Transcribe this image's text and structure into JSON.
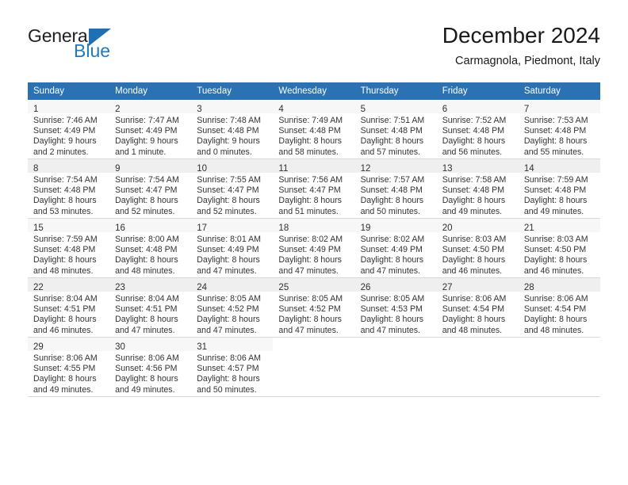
{
  "logo": {
    "word_one": "General",
    "word_two": "Blue",
    "triangle_color": "#1f6fb5",
    "blue_color": "#1f7ac0"
  },
  "header": {
    "title": "December 2024",
    "subtitle": "Carmagnola, Piedmont, Italy"
  },
  "theme": {
    "header_bg": "#2b72b4",
    "header_text": "#ffffff",
    "row_band_shaded": "#efefef",
    "row_band_light": "#f7f7f7",
    "cell_border": "#d8d8d8"
  },
  "calendar": {
    "weekday_headers": [
      "Sunday",
      "Monday",
      "Tuesday",
      "Wednesday",
      "Thursday",
      "Friday",
      "Saturday"
    ],
    "weeks": [
      {
        "shaded": false,
        "days": [
          {
            "day": "1",
            "sunrise": "Sunrise: 7:46 AM",
            "sunset": "Sunset: 4:49 PM",
            "daylight_1": "Daylight: 9 hours",
            "daylight_2": "and 2 minutes."
          },
          {
            "day": "2",
            "sunrise": "Sunrise: 7:47 AM",
            "sunset": "Sunset: 4:49 PM",
            "daylight_1": "Daylight: 9 hours",
            "daylight_2": "and 1 minute."
          },
          {
            "day": "3",
            "sunrise": "Sunrise: 7:48 AM",
            "sunset": "Sunset: 4:48 PM",
            "daylight_1": "Daylight: 9 hours",
            "daylight_2": "and 0 minutes."
          },
          {
            "day": "4",
            "sunrise": "Sunrise: 7:49 AM",
            "sunset": "Sunset: 4:48 PM",
            "daylight_1": "Daylight: 8 hours",
            "daylight_2": "and 58 minutes."
          },
          {
            "day": "5",
            "sunrise": "Sunrise: 7:51 AM",
            "sunset": "Sunset: 4:48 PM",
            "daylight_1": "Daylight: 8 hours",
            "daylight_2": "and 57 minutes."
          },
          {
            "day": "6",
            "sunrise": "Sunrise: 7:52 AM",
            "sunset": "Sunset: 4:48 PM",
            "daylight_1": "Daylight: 8 hours",
            "daylight_2": "and 56 minutes."
          },
          {
            "day": "7",
            "sunrise": "Sunrise: 7:53 AM",
            "sunset": "Sunset: 4:48 PM",
            "daylight_1": "Daylight: 8 hours",
            "daylight_2": "and 55 minutes."
          }
        ]
      },
      {
        "shaded": true,
        "days": [
          {
            "day": "8",
            "sunrise": "Sunrise: 7:54 AM",
            "sunset": "Sunset: 4:48 PM",
            "daylight_1": "Daylight: 8 hours",
            "daylight_2": "and 53 minutes."
          },
          {
            "day": "9",
            "sunrise": "Sunrise: 7:54 AM",
            "sunset": "Sunset: 4:47 PM",
            "daylight_1": "Daylight: 8 hours",
            "daylight_2": "and 52 minutes."
          },
          {
            "day": "10",
            "sunrise": "Sunrise: 7:55 AM",
            "sunset": "Sunset: 4:47 PM",
            "daylight_1": "Daylight: 8 hours",
            "daylight_2": "and 52 minutes."
          },
          {
            "day": "11",
            "sunrise": "Sunrise: 7:56 AM",
            "sunset": "Sunset: 4:47 PM",
            "daylight_1": "Daylight: 8 hours",
            "daylight_2": "and 51 minutes."
          },
          {
            "day": "12",
            "sunrise": "Sunrise: 7:57 AM",
            "sunset": "Sunset: 4:48 PM",
            "daylight_1": "Daylight: 8 hours",
            "daylight_2": "and 50 minutes."
          },
          {
            "day": "13",
            "sunrise": "Sunrise: 7:58 AM",
            "sunset": "Sunset: 4:48 PM",
            "daylight_1": "Daylight: 8 hours",
            "daylight_2": "and 49 minutes."
          },
          {
            "day": "14",
            "sunrise": "Sunrise: 7:59 AM",
            "sunset": "Sunset: 4:48 PM",
            "daylight_1": "Daylight: 8 hours",
            "daylight_2": "and 49 minutes."
          }
        ]
      },
      {
        "shaded": false,
        "days": [
          {
            "day": "15",
            "sunrise": "Sunrise: 7:59 AM",
            "sunset": "Sunset: 4:48 PM",
            "daylight_1": "Daylight: 8 hours",
            "daylight_2": "and 48 minutes."
          },
          {
            "day": "16",
            "sunrise": "Sunrise: 8:00 AM",
            "sunset": "Sunset: 4:48 PM",
            "daylight_1": "Daylight: 8 hours",
            "daylight_2": "and 48 minutes."
          },
          {
            "day": "17",
            "sunrise": "Sunrise: 8:01 AM",
            "sunset": "Sunset: 4:49 PM",
            "daylight_1": "Daylight: 8 hours",
            "daylight_2": "and 47 minutes."
          },
          {
            "day": "18",
            "sunrise": "Sunrise: 8:02 AM",
            "sunset": "Sunset: 4:49 PM",
            "daylight_1": "Daylight: 8 hours",
            "daylight_2": "and 47 minutes."
          },
          {
            "day": "19",
            "sunrise": "Sunrise: 8:02 AM",
            "sunset": "Sunset: 4:49 PM",
            "daylight_1": "Daylight: 8 hours",
            "daylight_2": "and 47 minutes."
          },
          {
            "day": "20",
            "sunrise": "Sunrise: 8:03 AM",
            "sunset": "Sunset: 4:50 PM",
            "daylight_1": "Daylight: 8 hours",
            "daylight_2": "and 46 minutes."
          },
          {
            "day": "21",
            "sunrise": "Sunrise: 8:03 AM",
            "sunset": "Sunset: 4:50 PM",
            "daylight_1": "Daylight: 8 hours",
            "daylight_2": "and 46 minutes."
          }
        ]
      },
      {
        "shaded": true,
        "days": [
          {
            "day": "22",
            "sunrise": "Sunrise: 8:04 AM",
            "sunset": "Sunset: 4:51 PM",
            "daylight_1": "Daylight: 8 hours",
            "daylight_2": "and 46 minutes."
          },
          {
            "day": "23",
            "sunrise": "Sunrise: 8:04 AM",
            "sunset": "Sunset: 4:51 PM",
            "daylight_1": "Daylight: 8 hours",
            "daylight_2": "and 47 minutes."
          },
          {
            "day": "24",
            "sunrise": "Sunrise: 8:05 AM",
            "sunset": "Sunset: 4:52 PM",
            "daylight_1": "Daylight: 8 hours",
            "daylight_2": "and 47 minutes."
          },
          {
            "day": "25",
            "sunrise": "Sunrise: 8:05 AM",
            "sunset": "Sunset: 4:52 PM",
            "daylight_1": "Daylight: 8 hours",
            "daylight_2": "and 47 minutes."
          },
          {
            "day": "26",
            "sunrise": "Sunrise: 8:05 AM",
            "sunset": "Sunset: 4:53 PM",
            "daylight_1": "Daylight: 8 hours",
            "daylight_2": "and 47 minutes."
          },
          {
            "day": "27",
            "sunrise": "Sunrise: 8:06 AM",
            "sunset": "Sunset: 4:54 PM",
            "daylight_1": "Daylight: 8 hours",
            "daylight_2": "and 48 minutes."
          },
          {
            "day": "28",
            "sunrise": "Sunrise: 8:06 AM",
            "sunset": "Sunset: 4:54 PM",
            "daylight_1": "Daylight: 8 hours",
            "daylight_2": "and 48 minutes."
          }
        ]
      },
      {
        "shaded": false,
        "days": [
          {
            "day": "29",
            "sunrise": "Sunrise: 8:06 AM",
            "sunset": "Sunset: 4:55 PM",
            "daylight_1": "Daylight: 8 hours",
            "daylight_2": "and 49 minutes."
          },
          {
            "day": "30",
            "sunrise": "Sunrise: 8:06 AM",
            "sunset": "Sunset: 4:56 PM",
            "daylight_1": "Daylight: 8 hours",
            "daylight_2": "and 49 minutes."
          },
          {
            "day": "31",
            "sunrise": "Sunrise: 8:06 AM",
            "sunset": "Sunset: 4:57 PM",
            "daylight_1": "Daylight: 8 hours",
            "daylight_2": "and 50 minutes."
          },
          {
            "day": "",
            "sunrise": "",
            "sunset": "",
            "daylight_1": "",
            "daylight_2": ""
          },
          {
            "day": "",
            "sunrise": "",
            "sunset": "",
            "daylight_1": "",
            "daylight_2": ""
          },
          {
            "day": "",
            "sunrise": "",
            "sunset": "",
            "daylight_1": "",
            "daylight_2": ""
          },
          {
            "day": "",
            "sunrise": "",
            "sunset": "",
            "daylight_1": "",
            "daylight_2": ""
          }
        ]
      }
    ]
  }
}
